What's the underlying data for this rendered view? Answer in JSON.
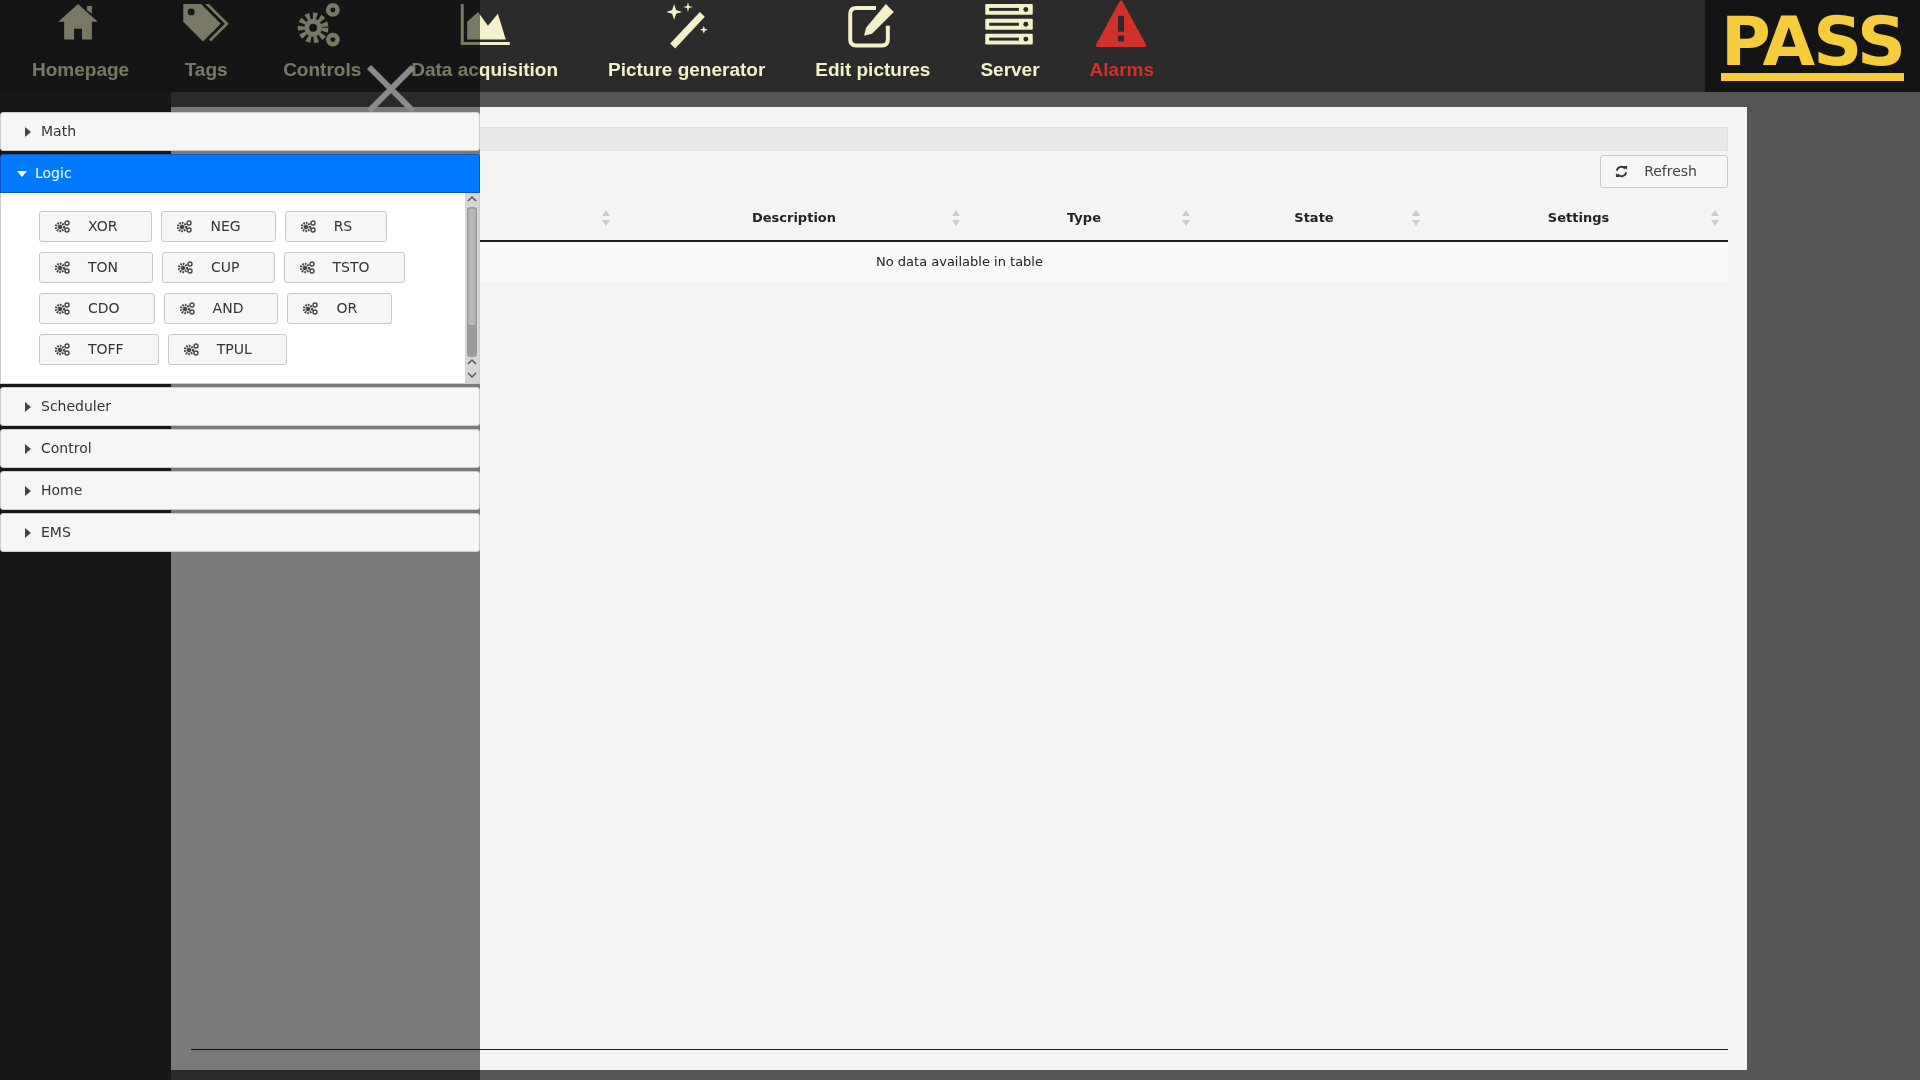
{
  "nav": [
    {
      "kind": "home",
      "label": "Homepage",
      "alert": false
    },
    {
      "kind": "tags",
      "label": "Tags",
      "alert": false
    },
    {
      "kind": "gears",
      "label": "Controls",
      "alert": false
    },
    {
      "kind": "chart",
      "label": "Data acquisition",
      "alert": false
    },
    {
      "kind": "wand",
      "label": "Picture generator",
      "alert": false
    },
    {
      "kind": "edit",
      "label": "Edit pictures",
      "alert": false
    },
    {
      "kind": "server",
      "label": "Server",
      "alert": false
    },
    {
      "kind": "warning",
      "label": "Alarms",
      "alert": true
    }
  ],
  "logo": "PASS",
  "refresh_button": "Refresh",
  "table": {
    "columns": [
      "Description",
      "Type",
      "State",
      "Settings"
    ],
    "empty_message": "No data available in table"
  },
  "sections": [
    {
      "label": "Math",
      "expanded": false
    },
    {
      "label": "Logic",
      "expanded": true,
      "rows": [
        [
          "XOR",
          "NEG",
          "RS"
        ],
        [
          "TON",
          "CUP",
          "TSTO"
        ],
        [
          "CDO",
          "AND",
          "OR"
        ],
        [
          "TOFF",
          "TPUL"
        ]
      ]
    },
    {
      "label": "Scheduler",
      "expanded": false
    },
    {
      "label": "Control",
      "expanded": false
    },
    {
      "label": "Home",
      "expanded": false
    },
    {
      "label": "EMS",
      "expanded": false
    }
  ]
}
